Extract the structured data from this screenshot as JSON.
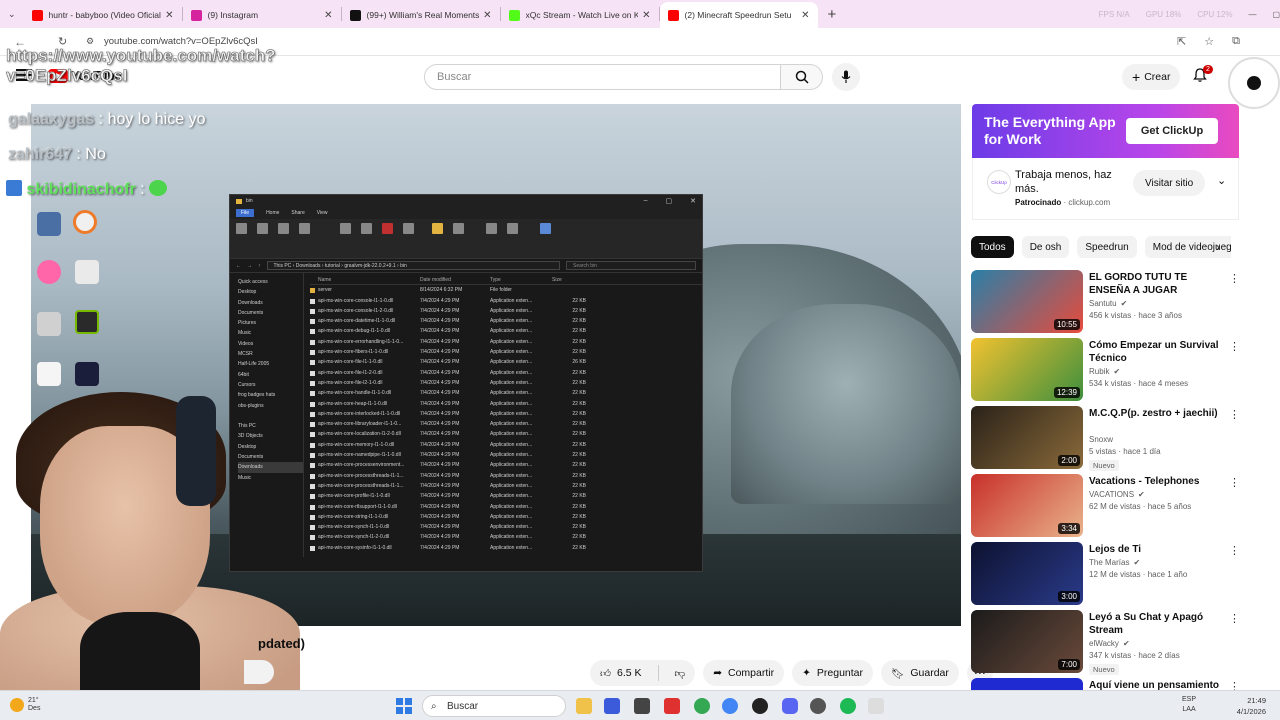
{
  "browser": {
    "tabs": [
      {
        "title": "huntr - babyboo (Video Oficial)",
        "favicon_color": "#ff0000",
        "active": false
      },
      {
        "title": "(9) Instagram",
        "favicon_color": "#d6249f",
        "active": false
      },
      {
        "title": "(99+) William's Real Moments: A",
        "favicon_color": "#111111",
        "active": false
      },
      {
        "title": "xQc Stream - Watch Live on Kick",
        "favicon_color": "#53fc18",
        "active": false
      },
      {
        "title": "(2) Minecraft Speedrun Setu",
        "favicon_color": "#ff0000",
        "active": true
      }
    ],
    "new_tab": "+",
    "hud": {
      "fps": "FPS N/A",
      "gpu": "GPU 18%",
      "cpu": "CPU 12%"
    },
    "url": "youtube.com/watch?v=OEpZlv6cQsI"
  },
  "youtube": {
    "logo_text": "YouTube",
    "search_placeholder": "Buscar",
    "create_label": "Crear",
    "notification_count": "2"
  },
  "overlay": {
    "url_line1": "https://www.youtube.com/watch?",
    "url_line2": "v=0EpZlv6cQsI",
    "chat": [
      {
        "user": "galaaxygas",
        "text": ": hoy lo hice yo"
      },
      {
        "user": "zahir647",
        "text": ": No"
      },
      {
        "user": "skibidinachofr",
        "text": ":"
      }
    ]
  },
  "explorer": {
    "title": "bin",
    "ribbon_tabs": [
      "File",
      "Home",
      "Share",
      "View"
    ],
    "path": "This PC › Downloads › tutorial › graalvm-jdk-22.0.2+9.1 › bin",
    "search": "Search bin",
    "columns": [
      "Name",
      "Date modified",
      "Type",
      "Size"
    ],
    "nav": [
      "Quick access",
      "Desktop",
      "Downloads",
      "Documents",
      "Pictures",
      "Music",
      "Videos",
      "MCSR",
      "Half-Life 2005",
      "64bit",
      "Cursors",
      "frog badges hats",
      "obs-plugins",
      "",
      "This PC",
      "3D Objects",
      "Desktop",
      "Documents",
      "Downloads",
      "Music"
    ],
    "rows": [
      {
        "name": "server",
        "date": "8/14/2024 6:32 PM",
        "type": "File folder",
        "size": "",
        "folder": true
      },
      {
        "name": "api-ms-win-core-console-l1-1-0.dll",
        "date": "7/4/2024 4:29 PM",
        "type": "Application exten...",
        "size": "22 KB"
      },
      {
        "name": "api-ms-win-core-console-l1-2-0.dll",
        "date": "7/4/2024 4:29 PM",
        "type": "Application exten...",
        "size": "22 KB"
      },
      {
        "name": "api-ms-win-core-datetime-l1-1-0.dll",
        "date": "7/4/2024 4:29 PM",
        "type": "Application exten...",
        "size": "22 KB"
      },
      {
        "name": "api-ms-win-core-debug-l1-1-0.dll",
        "date": "7/4/2024 4:29 PM",
        "type": "Application exten...",
        "size": "22 KB"
      },
      {
        "name": "api-ms-win-core-errorhandling-l1-1-0...",
        "date": "7/4/2024 4:29 PM",
        "type": "Application exten...",
        "size": "22 KB"
      },
      {
        "name": "api-ms-win-core-fibers-l1-1-0.dll",
        "date": "7/4/2024 4:29 PM",
        "type": "Application exten...",
        "size": "22 KB"
      },
      {
        "name": "api-ms-win-core-file-l1-1-0.dll",
        "date": "7/4/2024 4:29 PM",
        "type": "Application exten...",
        "size": "26 KB"
      },
      {
        "name": "api-ms-win-core-file-l1-2-0.dll",
        "date": "7/4/2024 4:29 PM",
        "type": "Application exten...",
        "size": "22 KB"
      },
      {
        "name": "api-ms-win-core-file-l2-1-0.dll",
        "date": "7/4/2024 4:29 PM",
        "type": "Application exten...",
        "size": "22 KB"
      },
      {
        "name": "api-ms-win-core-handle-l1-1-0.dll",
        "date": "7/4/2024 4:29 PM",
        "type": "Application exten...",
        "size": "22 KB"
      },
      {
        "name": "api-ms-win-core-heap-l1-1-0.dll",
        "date": "7/4/2024 4:29 PM",
        "type": "Application exten...",
        "size": "22 KB"
      },
      {
        "name": "api-ms-win-core-interlocked-l1-1-0.dll",
        "date": "7/4/2024 4:29 PM",
        "type": "Application exten...",
        "size": "22 KB"
      },
      {
        "name": "api-ms-win-core-libraryloader-l1-1-0...",
        "date": "7/4/2024 4:29 PM",
        "type": "Application exten...",
        "size": "22 KB"
      },
      {
        "name": "api-ms-win-core-localization-l1-2-0.dll",
        "date": "7/4/2024 4:29 PM",
        "type": "Application exten...",
        "size": "22 KB"
      },
      {
        "name": "api-ms-win-core-memory-l1-1-0.dll",
        "date": "7/4/2024 4:29 PM",
        "type": "Application exten...",
        "size": "22 KB"
      },
      {
        "name": "api-ms-win-core-namedpipe-l1-1-0.dll",
        "date": "7/4/2024 4:29 PM",
        "type": "Application exten...",
        "size": "22 KB"
      },
      {
        "name": "api-ms-win-core-processenvironment...",
        "date": "7/4/2024 4:29 PM",
        "type": "Application exten...",
        "size": "22 KB"
      },
      {
        "name": "api-ms-win-core-processthreads-l1-1...",
        "date": "7/4/2024 4:29 PM",
        "type": "Application exten...",
        "size": "22 KB"
      },
      {
        "name": "api-ms-win-core-processthreads-l1-1...",
        "date": "7/4/2024 4:29 PM",
        "type": "Application exten...",
        "size": "22 KB"
      },
      {
        "name": "api-ms-win-core-profile-l1-1-0.dll",
        "date": "7/4/2024 4:29 PM",
        "type": "Application exten...",
        "size": "22 KB"
      },
      {
        "name": "api-ms-win-core-rtlsupport-l1-1-0.dll",
        "date": "7/4/2024 4:29 PM",
        "type": "Application exten...",
        "size": "22 KB"
      },
      {
        "name": "api-ms-win-core-string-l1-1-0.dll",
        "date": "7/4/2024 4:29 PM",
        "type": "Application exten...",
        "size": "22 KB"
      },
      {
        "name": "api-ms-win-core-synch-l1-1-0.dll",
        "date": "7/4/2024 4:29 PM",
        "type": "Application exten...",
        "size": "22 KB"
      },
      {
        "name": "api-ms-win-core-synch-l1-2-0.dll",
        "date": "7/4/2024 4:29 PM",
        "type": "Application exten...",
        "size": "22 KB"
      },
      {
        "name": "api-ms-win-core-sysinfo-l1-1-0.dll",
        "date": "7/4/2024 4:29 PM",
        "type": "Application exten...",
        "size": "22 KB"
      }
    ]
  },
  "video": {
    "title_visible": "pdated)",
    "likes": "6.5 K",
    "share": "Compartir",
    "ask": "Preguntar",
    "save": "Guardar"
  },
  "ad": {
    "banner_text": "The Everything App for Work",
    "banner_cta": "Get ClickUp",
    "logo_text": "ClickUp",
    "headline": "Trabaja menos, haz más.",
    "sponsored": "Patrocinado",
    "domain": "clickup.com",
    "visit": "Visitar sitio"
  },
  "chips": [
    "Todos",
    "De osh",
    "Speedrun",
    "Mod de videojuegos"
  ],
  "recommendations": [
    {
      "title": "EL GORDO TUTU TE ENSEÑA A JUGAR MINECRAFT",
      "channel": "Santutu",
      "verified": true,
      "stats": "456 k vistas · hace 3 años",
      "duration": "10:55",
      "badge": "",
      "thumb_colors": [
        "#2a7fa8",
        "#e84b3c"
      ]
    },
    {
      "title": "Cómo Empezar un Survival Técnico",
      "channel": "Rubik",
      "verified": true,
      "stats": "534 k vistas · hace 4 meses",
      "duration": "12:39",
      "badge": "",
      "thumb_colors": [
        "#f2c230",
        "#3d8f3d"
      ]
    },
    {
      "title": "M.C.Q.P(p. zestro + jaechii)",
      "channel": "Snoxw",
      "verified": false,
      "stats": "5 vistas · hace 1 día",
      "duration": "2:00",
      "badge": "Nuevo",
      "thumb_colors": [
        "#2a2218",
        "#8a6a3a"
      ]
    },
    {
      "title": "Vacations - Telephones",
      "channel": "VACATIONS",
      "verified": true,
      "stats": "62 M de vistas · hace 5 años",
      "duration": "3:34",
      "badge": "",
      "thumb_colors": [
        "#c8302a",
        "#e9b38a"
      ]
    },
    {
      "title": "Lejos de Ti",
      "channel": "The Marías",
      "verified": true,
      "stats": "12 M de vistas · hace 1 año",
      "duration": "3:00",
      "badge": "",
      "thumb_colors": [
        "#0d1230",
        "#2a3a8a"
      ]
    },
    {
      "title": "Leyó a Su Chat y Apagó Stream",
      "channel": "elWacky",
      "verified": true,
      "stats": "347 k vistas · hace 2 días",
      "duration": "7:00",
      "badge": "Nuevo",
      "thumb_colors": [
        "#1b1b1b",
        "#6a4a3a"
      ]
    },
    {
      "title": "Aquí viene un pensamiento |",
      "channel": "",
      "verified": false,
      "stats": "",
      "duration": "",
      "badge": "",
      "thumb_colors": [
        "#1f2ad0",
        "#1f2ad0"
      ]
    }
  ],
  "taskbar": {
    "weather_temp": "21°",
    "weather_desc": "Des",
    "search": "Buscar",
    "lang": "ESP",
    "lang2": "LAA",
    "time": "21:49",
    "date": "4/1/2026"
  }
}
